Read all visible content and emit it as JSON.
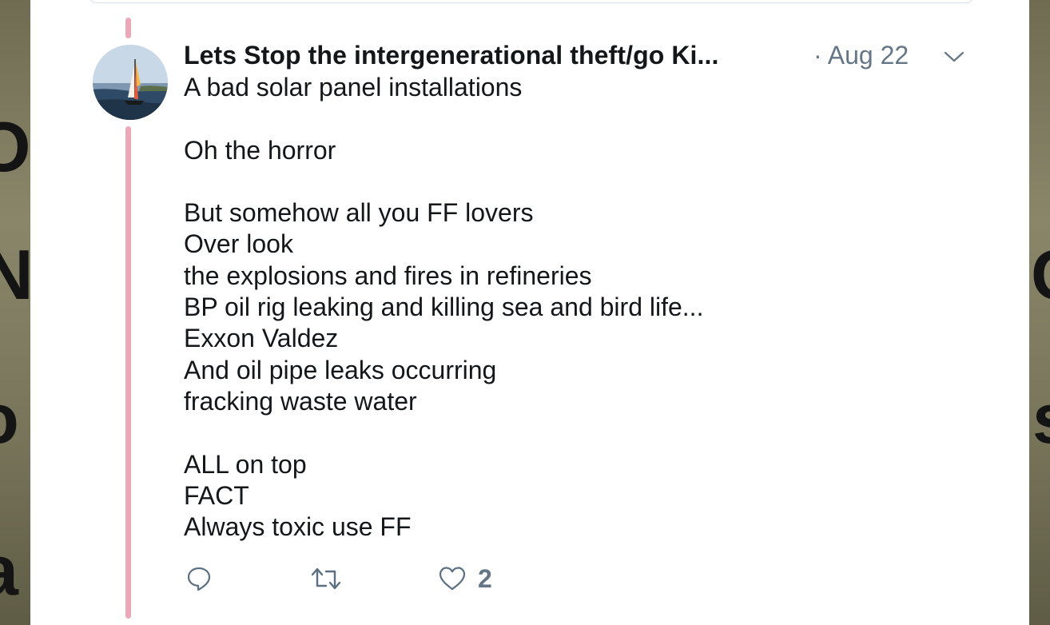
{
  "background": {
    "left_glyphs": [
      "O",
      "N",
      "o",
      "a"
    ],
    "right_glyphs": [
      "C",
      "s"
    ]
  },
  "tweet": {
    "author": "Lets Stop the intergenerational theft/go Ki...",
    "date": "· Aug 22",
    "lines": [
      "A bad solar panel installations",
      "",
      "Oh the horror",
      "",
      "But somehow all you FF lovers",
      "Over look",
      "the explosions and fires in refineries",
      "BP oil rig leaking and killing sea and bird life...",
      "Exxon Valdez",
      "And oil pipe leaks occurring",
      "fracking waste water",
      "",
      "ALL on top",
      "FACT",
      "Always toxic use FF"
    ],
    "like_count": "2"
  },
  "icons": {
    "reply": "reply-icon",
    "retweet": "retweet-icon",
    "like": "heart-icon",
    "caret": "chevron-down-icon",
    "avatar": "sailboat-photo"
  },
  "colors": {
    "thread_line": "#eaa8b8",
    "text": "#14171a",
    "muted": "#657786",
    "icon_blue": "#5b7083"
  }
}
